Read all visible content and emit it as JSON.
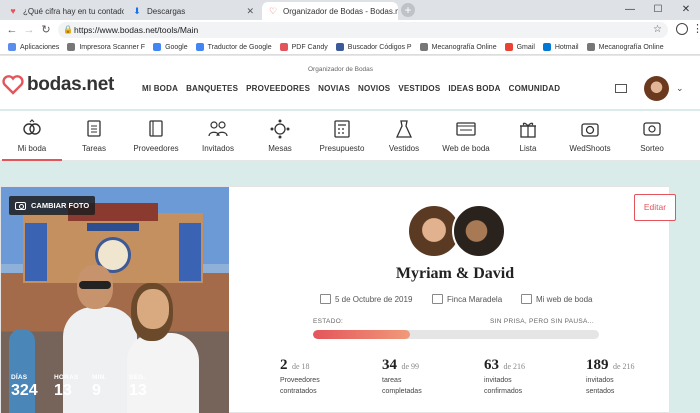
{
  "browser": {
    "tabs": [
      {
        "label": "¿Qué cifra hay en tu contador h",
        "active": false
      },
      {
        "label": "Descargas",
        "active": false
      },
      {
        "label": "Organizador de Bodas - Bodas.ne",
        "active": true
      }
    ],
    "url": "https://www.bodas.net/tools/Main",
    "bookmarks": [
      {
        "label": "Aplicaciones",
        "color": "#5b8def"
      },
      {
        "label": "Impresora Scanner F",
        "color": "#777777"
      },
      {
        "label": "Google",
        "color": "#4285f4"
      },
      {
        "label": "Traductor de Google",
        "color": "#4285f4"
      },
      {
        "label": "PDF Candy",
        "color": "#e4555b"
      },
      {
        "label": "Buscador Códigos P",
        "color": "#3a5a9a"
      },
      {
        "label": "Mecanografía Online",
        "color": "#777777"
      },
      {
        "label": "Gmail",
        "color": "#ea4335"
      },
      {
        "label": "Hotmail",
        "color": "#0078d4"
      },
      {
        "label": "Mecanografía Online",
        "color": "#777777"
      }
    ]
  },
  "site": {
    "logo_text": "bodas.net",
    "tagline": "Organizador de Bodas",
    "nav": [
      "MI BODA",
      "BANQUETES",
      "PROVEEDORES",
      "NOVIAS",
      "NOVIOS",
      "VESTIDOS",
      "IDEAS BODA",
      "COMUNIDAD"
    ]
  },
  "tools": [
    {
      "label": "Mi boda",
      "icon": "rings-icon",
      "active": true
    },
    {
      "label": "Tareas",
      "icon": "checklist-icon",
      "active": false
    },
    {
      "label": "Proveedores",
      "icon": "book-icon",
      "active": false
    },
    {
      "label": "Invitados",
      "icon": "guests-icon",
      "active": false
    },
    {
      "label": "Mesas",
      "icon": "table-icon",
      "active": false
    },
    {
      "label": "Presupuesto",
      "icon": "calculator-icon",
      "active": false
    },
    {
      "label": "Vestidos",
      "icon": "dress-icon",
      "active": false
    },
    {
      "label": "Web de boda",
      "icon": "web-icon",
      "active": false
    },
    {
      "label": "Lista",
      "icon": "gift-icon",
      "active": false
    },
    {
      "label": "WedShoots",
      "icon": "camera-icon",
      "active": false
    },
    {
      "label": "Sorteo",
      "icon": "ticket-icon",
      "active": false
    }
  ],
  "hero": {
    "change_photo": "CAMBIAR FOTO",
    "countdown": [
      {
        "label": "DÍAS",
        "value": "324"
      },
      {
        "label": "HORAS",
        "value": "13"
      },
      {
        "label": "MIN.",
        "value": "9"
      },
      {
        "label": "SEG.",
        "value": "13"
      }
    ],
    "edit": "Editar",
    "couple": "Myriam & David",
    "date": "5 de Octubre de 2019",
    "venue": "Finca Maradela",
    "web_link": "Mi web de boda",
    "status_label": "ESTADO:",
    "status_text": "SIN PRISA, PERO SIN PAUSA...",
    "progress_fraction": 0.34
  },
  "stats": [
    {
      "value": "2",
      "total": "de 18",
      "label1": "Proveedores",
      "label2": "contratados"
    },
    {
      "value": "34",
      "total": "de 99",
      "label1": "tareas",
      "label2": "completadas"
    },
    {
      "value": "63",
      "total": "de 216",
      "label1": "invitados",
      "label2": "confirmados"
    },
    {
      "value": "189",
      "total": "de 216",
      "label1": "invitados",
      "label2": "sentados"
    }
  ],
  "colors": {
    "accent": "#e4555b",
    "background": "#d9ece9"
  }
}
